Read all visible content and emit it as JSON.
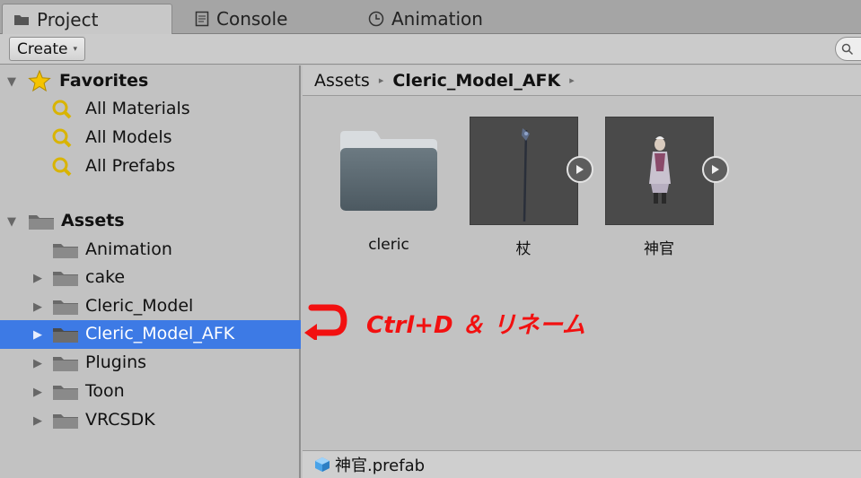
{
  "tabs": [
    {
      "label": "Project",
      "icon": "folder-tab-icon"
    },
    {
      "label": "Console",
      "icon": "console-icon"
    },
    {
      "label": "Animation",
      "icon": "clock-icon"
    }
  ],
  "toolbar": {
    "create_label": "Create",
    "create_caret": "▾"
  },
  "tree": {
    "favorites": {
      "label": "Favorites",
      "items": [
        "All Materials",
        "All Models",
        "All Prefabs"
      ]
    },
    "assets": {
      "label": "Assets",
      "items": [
        "Animation",
        "cake",
        "Cleric_Model",
        "Cleric_Model_AFK",
        "Plugins",
        "Toon",
        "VRCSDK"
      ],
      "selected": "Cleric_Model_AFK"
    }
  },
  "breadcrumb": {
    "root": "Assets",
    "current": "Cleric_Model_AFK",
    "sep": "▸"
  },
  "assets": [
    {
      "label": "cleric",
      "kind": "folder"
    },
    {
      "label": "杖",
      "kind": "prefab"
    },
    {
      "label": "神官",
      "kind": "prefab"
    }
  ],
  "status": {
    "file": "神官.prefab"
  },
  "annotation": {
    "text": "Ctrl+D ＆ リネーム",
    "color": "#f21010"
  },
  "colors": {
    "selection": "#3d7ae5",
    "panel": "#c2c2c2",
    "favorites_star": "#f5c400"
  }
}
